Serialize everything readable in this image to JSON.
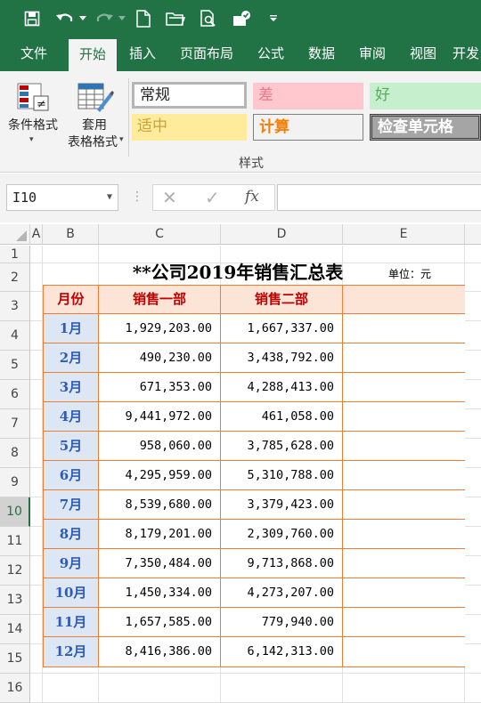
{
  "toolbar": {
    "icons": [
      "save-icon",
      "undo-icon",
      "redo-icon",
      "new-file-icon",
      "open-folder-icon",
      "print-preview-icon",
      "touch-mode-icon",
      "customize-icon"
    ]
  },
  "tabs": [
    "文件",
    "开始",
    "插入",
    "页面布局",
    "公式",
    "数据",
    "审阅",
    "视图",
    "开发"
  ],
  "ribbon": {
    "conditional_format": "条件格式",
    "table_format_line1": "套用",
    "table_format_line2": "表格格式",
    "group_label": "样式",
    "styles": {
      "normal": "常规",
      "bad": "差",
      "good": "好",
      "neutral": "适中",
      "calculation": "计算",
      "check_cell": "检查单元格"
    }
  },
  "formula_bar": {
    "name_box": "I10",
    "fx_label": "fx",
    "value": ""
  },
  "columns": [
    "A",
    "B",
    "C",
    "D",
    "E"
  ],
  "rows": [
    "1",
    "2",
    "3",
    "4",
    "5",
    "6",
    "7",
    "8",
    "9",
    "10",
    "11",
    "12",
    "13",
    "14",
    "15",
    "16"
  ],
  "sheet": {
    "title": "**公司2019年销售汇总表",
    "unit": "单位：元",
    "headers": [
      "月份",
      "销售一部",
      "销售二部",
      ""
    ],
    "data": [
      [
        "1月",
        "1,929,203.00",
        "1,667,337.00"
      ],
      [
        "2月",
        "490,230.00",
        "3,438,792.00"
      ],
      [
        "3月",
        "671,353.00",
        "4,288,413.00"
      ],
      [
        "4月",
        "9,441,972.00",
        "461,058.00"
      ],
      [
        "5月",
        "958,060.00",
        "3,785,628.00"
      ],
      [
        "6月",
        "4,295,959.00",
        "5,310,788.00"
      ],
      [
        "7月",
        "8,539,680.00",
        "3,379,423.00"
      ],
      [
        "8月",
        "8,179,201.00",
        "2,309,760.00"
      ],
      [
        "9月",
        "7,350,484.00",
        "9,713,868.00"
      ],
      [
        "10月",
        "1,450,334.00",
        "4,273,207.00"
      ],
      [
        "11月",
        "1,657,585.00",
        "779,940.00"
      ],
      [
        "12月",
        "8,416,386.00",
        "6,142,313.00"
      ]
    ]
  },
  "colors": {
    "brand": "#217346",
    "table_border": "#ed7d31",
    "header_fill": "#fce4d6",
    "header_text": "#c00000",
    "month_fill": "#dde6f3",
    "month_text": "#2e5bb8"
  }
}
